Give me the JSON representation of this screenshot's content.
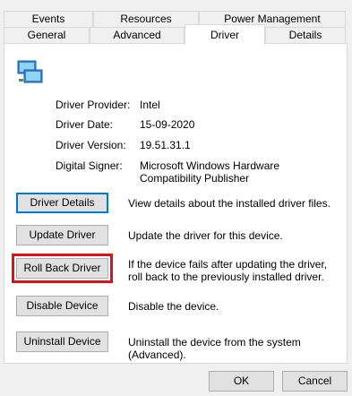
{
  "tabs": {
    "row1": [
      "Events",
      "Resources",
      "Power Management"
    ],
    "row2": [
      "General",
      "Advanced",
      "Driver",
      "Details"
    ],
    "active": "Driver"
  },
  "device_icon": "network-adapter-icon",
  "info": {
    "provider_label": "Driver Provider:",
    "provider_value": "Intel",
    "date_label": "Driver Date:",
    "date_value": "15-09-2020",
    "version_label": "Driver Version:",
    "version_value": "19.51.31.1",
    "signer_label": "Digital Signer:",
    "signer_value": "Microsoft Windows Hardware Compatibility Publisher"
  },
  "actions": [
    {
      "label": "Driver Details",
      "description": "View details about the installed driver files."
    },
    {
      "label": "Update Driver",
      "description": "Update the driver for this device."
    },
    {
      "label": "Roll Back Driver",
      "description": "If the device fails after updating the driver, roll back to the previously installed driver."
    },
    {
      "label": "Disable Device",
      "description": "Disable the device."
    },
    {
      "label": "Uninstall Device",
      "description": "Uninstall the device from the system (Advanced)."
    }
  ],
  "footer": {
    "ok_label": "OK",
    "cancel_label": "Cancel"
  },
  "colors": {
    "focus": "#0078d7",
    "highlight": "#e0101a"
  }
}
